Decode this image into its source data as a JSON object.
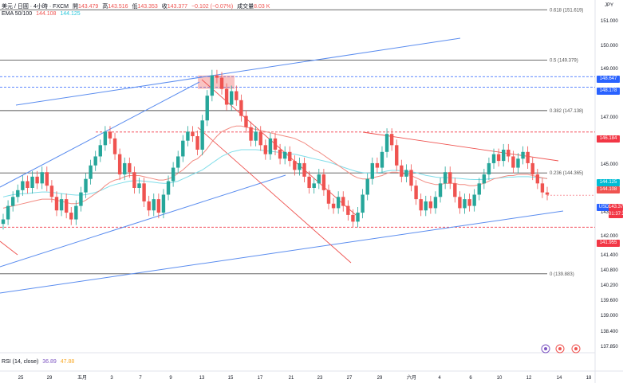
{
  "header": {
    "symbol": "美元 / 日圓 · 4小時 · FXCM",
    "open_label": "開",
    "open": "143.479",
    "high_label": "高",
    "high": "143.516",
    "low_label": "低",
    "low": "143.353",
    "close_label": "收",
    "close": "143.377",
    "change": "−0.102 (−0.07%)",
    "volume_label": "成交量",
    "volume": "8.03 K",
    "ema_label": "EMA 50/100",
    "ema50": "144.108",
    "ema100": "144.125",
    "rsi_label": "RSI (14, close)",
    "rsi1": "36.89",
    "rsi2": "47.88",
    "currency": "JPY"
  },
  "price_tags": {
    "t148647": "148.647",
    "t148178": "148.178",
    "t146184": "146.184",
    "t144125": "144.125",
    "t144108": "144.108",
    "pair": "USDJPY",
    "last": "143.377",
    "countdown": "01:37:27",
    "t141955": "141.955"
  },
  "colors": {
    "up": "#26a69a",
    "down": "#ef5350",
    "ema50": "#f28b82",
    "ema100": "#7fdde9",
    "trend_blue": "#5b8def",
    "trend_red": "#ef5350",
    "fib": "#555555",
    "tag_blue": "#2962ff",
    "tag_red": "#f23645"
  },
  "chart_data": {
    "type": "candlestick",
    "title": "美元 / 日圓 · 4小時 · FXCM",
    "ylabel": "JPY",
    "ylim": [
      137.7,
      151.7
    ],
    "x_ticks": [
      "25",
      "29",
      "五月",
      "3",
      "7",
      "9",
      "13",
      "15",
      "17",
      "21",
      "23",
      "27",
      "29",
      "六月",
      "4",
      "6",
      "10",
      "12",
      "14",
      "18"
    ],
    "y_ticks": [
      "151.000",
      "150.000",
      "149.000",
      "148.000",
      "147.000",
      "146.000",
      "145.000",
      "144.000",
      "143.000",
      "142.000",
      "141.400",
      "140.800",
      "140.200",
      "139.600",
      "139.000",
      "138.400",
      "137.850"
    ],
    "fib_levels": [
      {
        "label": "0.618 (151.619)",
        "value": 151.619
      },
      {
        "label": "0.5 (149.379)",
        "value": 149.379
      },
      {
        "label": "0.382 (147.138)",
        "value": 147.138
      },
      {
        "label": "0.236 (144.365)",
        "value": 144.365
      },
      {
        "label": "0 (139.883)",
        "value": 139.883
      }
    ],
    "horizontal_levels": [
      148.647,
      148.178,
      146.184,
      141.955
    ],
    "closes": [
      142.3,
      142.9,
      143.3,
      143.6,
      144.0,
      143.7,
      144.2,
      143.9,
      144.4,
      143.8,
      143.3,
      142.7,
      143.2,
      142.6,
      142.3,
      142.9,
      143.5,
      144.1,
      144.7,
      145.1,
      145.6,
      146.2,
      145.9,
      145.2,
      144.3,
      144.8,
      144.4,
      143.7,
      143.9,
      143.1,
      142.7,
      143.2,
      142.6,
      143.4,
      144.0,
      144.6,
      145.1,
      145.8,
      146.2,
      146.0,
      145.4,
      146.7,
      147.8,
      148.7,
      148.6,
      148.1,
      147.4,
      148.0,
      147.6,
      146.9,
      146.4,
      145.8,
      146.2,
      145.6,
      145.2,
      145.9,
      145.4,
      145.0,
      145.3,
      144.9,
      144.5,
      144.8,
      144.2,
      143.7,
      143.9,
      144.3,
      143.6,
      143.0,
      142.8,
      143.3,
      142.9,
      142.5,
      142.2,
      142.6,
      143.4,
      144.1,
      144.8,
      144.6,
      145.3,
      146.1,
      145.6,
      144.7,
      144.2,
      144.5,
      143.8,
      143.2,
      142.7,
      143.1,
      142.8,
      143.3,
      143.9,
      144.4,
      143.9,
      143.3,
      142.8,
      143.2,
      142.9,
      143.4,
      143.9,
      144.3,
      144.8,
      145.2,
      144.9,
      145.4,
      145.1,
      144.6,
      145.0,
      145.3,
      144.8,
      144.3,
      143.9,
      143.5,
      143.4
    ],
    "ema50": [
      142.8,
      142.85,
      142.9,
      142.95,
      143.0,
      143.05,
      143.1,
      143.15,
      143.2,
      143.2,
      143.2,
      143.15,
      143.1,
      143.05,
      143.0,
      143.0,
      143.05,
      143.15,
      143.3,
      143.45,
      143.6,
      143.8,
      143.95,
      144.05,
      144.1,
      144.2,
      144.25,
      144.25,
      144.25,
      144.2,
      144.15,
      144.1,
      144.05,
      144.05,
      144.1,
      144.2,
      144.35,
      144.5,
      144.7,
      144.9,
      145.0,
      145.2,
      145.45,
      145.75,
      146.0,
      146.2,
      146.3,
      146.4,
      146.45,
      146.45,
      146.4,
      146.35,
      146.3,
      146.25,
      146.2,
      146.15,
      146.1,
      146.05,
      146.0,
      145.95,
      145.9,
      145.8,
      145.7,
      145.55,
      145.4,
      145.3,
      145.15,
      145.0,
      144.85,
      144.7,
      144.55,
      144.4,
      144.25,
      144.15,
      144.1,
      144.1,
      144.15,
      144.2,
      144.25,
      144.35,
      144.4,
      144.4,
      144.35,
      144.3,
      144.25,
      144.15,
      144.05,
      143.95,
      143.9,
      143.85,
      143.85,
      143.9,
      143.9,
      143.9,
      143.85,
      143.85,
      143.8,
      143.8,
      143.85,
      143.9,
      144.0,
      144.1,
      144.15,
      144.2,
      144.25,
      144.25,
      144.3,
      144.3,
      144.3,
      144.25,
      144.2,
      144.15,
      144.108
    ],
    "ema100": [
      143.3,
      143.35,
      143.4,
      143.42,
      143.45,
      143.45,
      143.48,
      143.5,
      143.52,
      143.52,
      143.5,
      143.48,
      143.45,
      143.42,
      143.4,
      143.38,
      143.38,
      143.4,
      143.45,
      143.5,
      143.58,
      143.68,
      143.78,
      143.85,
      143.9,
      143.95,
      144.0,
      144.02,
      144.02,
      144.0,
      143.98,
      143.95,
      143.92,
      143.9,
      143.9,
      143.95,
      144.0,
      144.1,
      144.2,
      144.3,
      144.4,
      144.5,
      144.65,
      144.8,
      144.95,
      145.1,
      145.2,
      145.3,
      145.35,
      145.4,
      145.4,
      145.4,
      145.4,
      145.38,
      145.35,
      145.33,
      145.3,
      145.28,
      145.25,
      145.22,
      145.2,
      145.15,
      145.1,
      145.05,
      145.0,
      144.95,
      144.9,
      144.85,
      144.78,
      144.7,
      144.62,
      144.55,
      144.48,
      144.42,
      144.38,
      144.36,
      144.36,
      144.38,
      144.4,
      144.45,
      144.48,
      144.48,
      144.46,
      144.44,
      144.42,
      144.38,
      144.32,
      144.26,
      144.22,
      144.18,
      144.16,
      144.16,
      144.15,
      144.14,
      144.12,
      144.1,
      144.08,
      144.07,
      144.07,
      144.08,
      144.1,
      144.12,
      144.14,
      144.16,
      144.18,
      144.18,
      144.2,
      144.2,
      144.2,
      144.18,
      144.16,
      144.14,
      144.125
    ]
  }
}
